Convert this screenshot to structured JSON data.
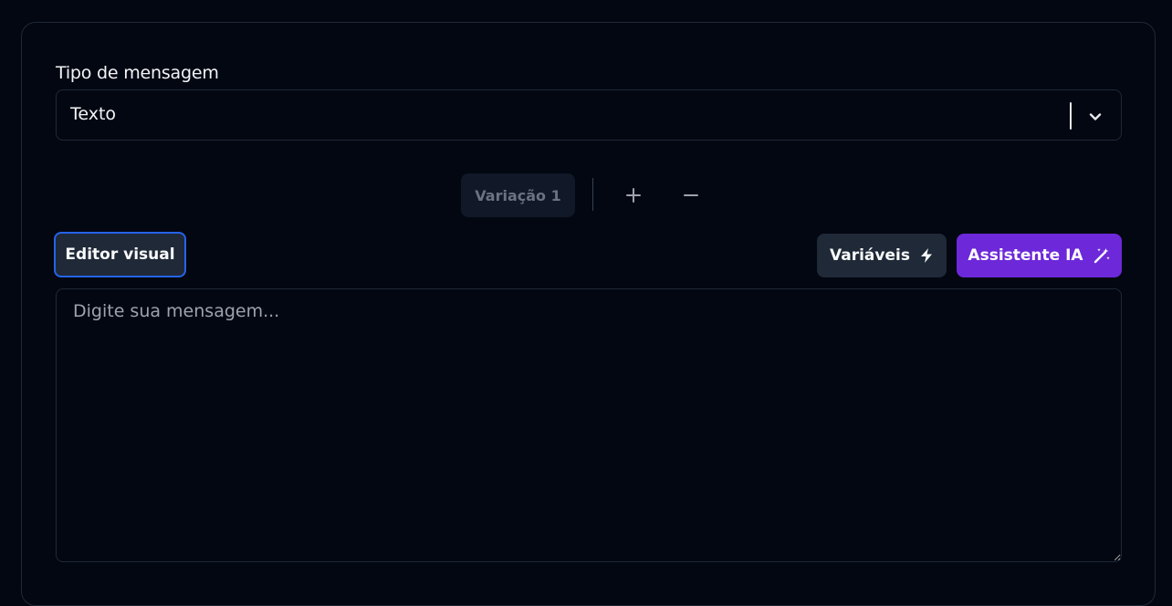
{
  "message_type": {
    "label": "Tipo de mensagem",
    "selected": "Texto"
  },
  "variations": {
    "tabs": [
      "Variação 1"
    ],
    "add_icon": "plus-icon",
    "remove_icon": "minus-icon"
  },
  "toolbar": {
    "editor_label": "Editor visual",
    "variables_label": "Variáveis",
    "variables_icon": "lightning-icon",
    "ai_label": "Assistente IA",
    "ai_icon": "magic-wand-icon"
  },
  "message": {
    "placeholder": "Digite sua mensagem...",
    "value": ""
  },
  "colors": {
    "background": "#030712",
    "border": "#1f2937",
    "accent_blue": "#2563eb",
    "accent_purple": "#6d28d9"
  }
}
